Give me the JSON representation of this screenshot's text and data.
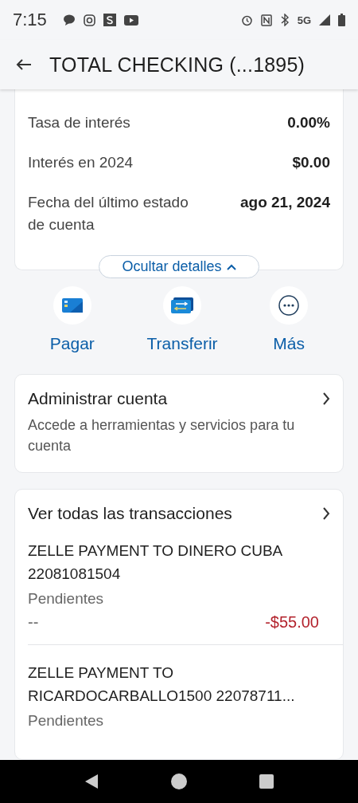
{
  "status_bar": {
    "time": "7:15",
    "network": "5G"
  },
  "header": {
    "title": "TOTAL CHECKING (...1895)"
  },
  "details": [
    {
      "label": "Tasa de interés",
      "value": "0.00%"
    },
    {
      "label": "Interés en 2024",
      "value": "$0.00"
    },
    {
      "label": "Fecha del último estado de cuenta",
      "value": "ago 21, 2024"
    }
  ],
  "toggle_button": "Ocultar detalles",
  "actions": [
    {
      "kind": "pay",
      "label": "Pagar"
    },
    {
      "kind": "transfer",
      "label": "Transferir"
    },
    {
      "kind": "more",
      "label": "Más"
    }
  ],
  "manage_card": {
    "title": "Administrar cuenta",
    "description": "Accede a herramientas y servicios para tu cuenta"
  },
  "transactions": {
    "title": "Ver todas las transacciones",
    "items": [
      {
        "description": "ZELLE PAYMENT TO DINERO CUBA 22081081504",
        "status": "Pendientes",
        "date": "--",
        "amount": "-$55.00"
      },
      {
        "description": "ZELLE PAYMENT TO RICARDOCARBALLO1500 22078711...",
        "status": "Pendientes"
      }
    ]
  }
}
